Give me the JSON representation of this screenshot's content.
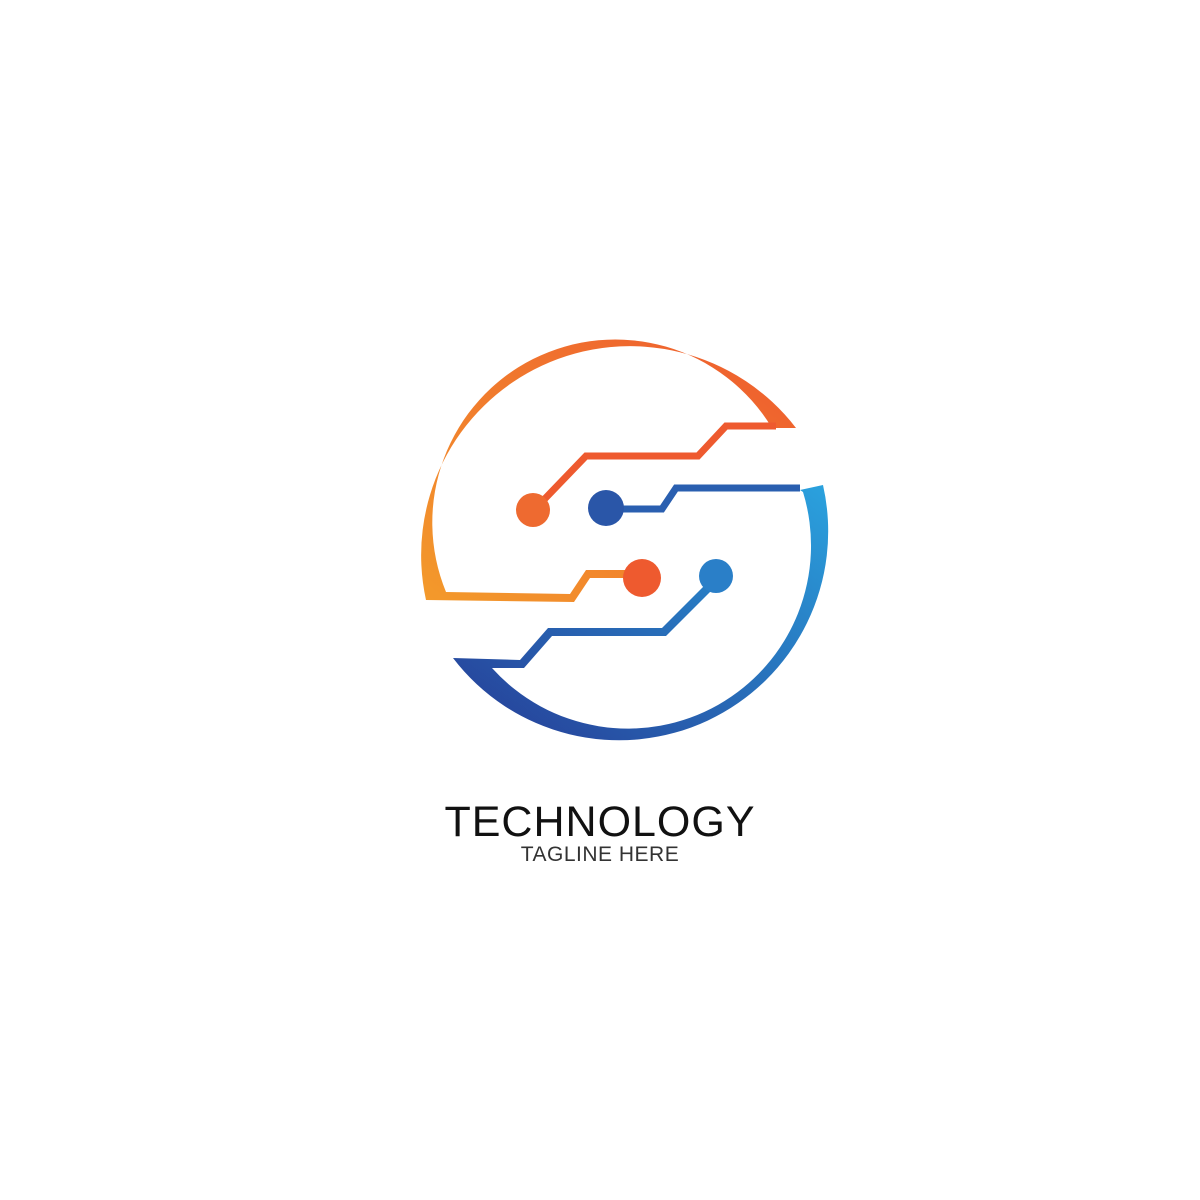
{
  "brand": {
    "name": "TECHNOLOGY",
    "tagline": "TAGLINE HERE"
  },
  "logo": {
    "icon": "circuit-s-icon",
    "colors": {
      "orange_light": "#f39a2b",
      "orange": "#ee5a2f",
      "blue_light": "#2aa2de",
      "blue_dark": "#263b95",
      "text": "#111111",
      "tagline_text": "#333333"
    }
  }
}
